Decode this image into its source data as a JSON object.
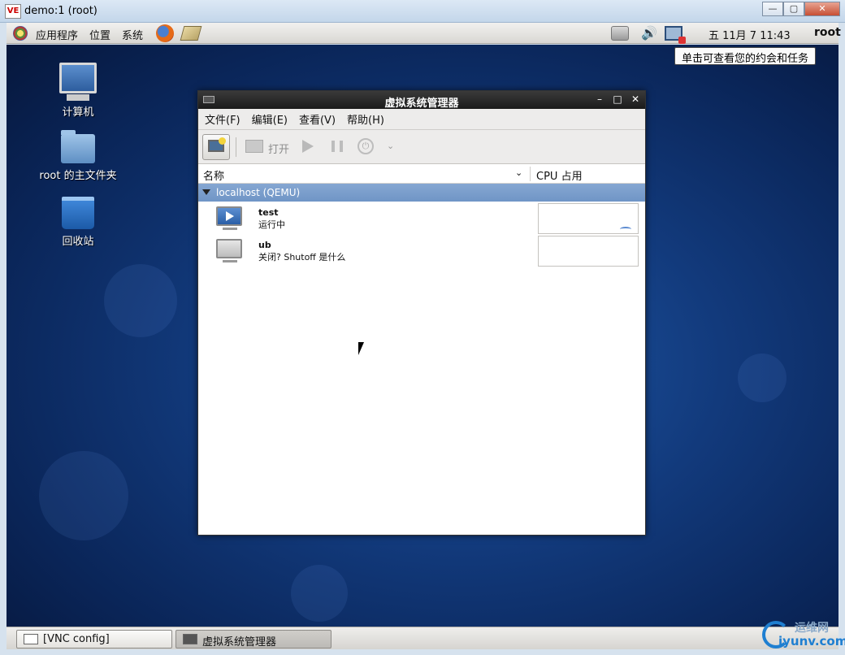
{
  "vnc_window": {
    "logo_text": "VE",
    "title": "demo:1 (root)",
    "minimize": "—",
    "maximize": "▢",
    "close": "✕"
  },
  "top_panel": {
    "menus": [
      "应用程序",
      "位置",
      "系统"
    ],
    "clock": "五 11月  7 11:43",
    "user": "root",
    "volume_glyph": "🔊"
  },
  "tooltip": "单击可查看您的约会和任务",
  "desktop_icons": [
    {
      "label": "计算机"
    },
    {
      "label": "root 的主文件夹"
    },
    {
      "label": "回收站"
    }
  ],
  "vm_manager": {
    "title": "虚拟系统管理器",
    "controls": {
      "minimize": "–",
      "maximize": "□",
      "close": "✕"
    },
    "menus": [
      "文件(F)",
      "编辑(E)",
      "查看(V)",
      "帮助(H)"
    ],
    "toolbar": {
      "open_label": "打开",
      "power_glyph": "⏻",
      "dropdown_glyph": "⌄"
    },
    "columns": {
      "name": "名称",
      "sort_glyph": "⌄",
      "cpu": "CPU 占用"
    },
    "host": "localhost (QEMU)",
    "vms": [
      {
        "name": "test",
        "status": "运行中",
        "state": "running"
      },
      {
        "name": "ub",
        "status": "关闭? Shutoff 是什么",
        "state": "off"
      }
    ]
  },
  "taskbar": {
    "items": [
      "[VNC config]",
      "虚拟系统管理器"
    ]
  },
  "watermark": {
    "line1": "运维网",
    "line2": "iyunv.com"
  }
}
